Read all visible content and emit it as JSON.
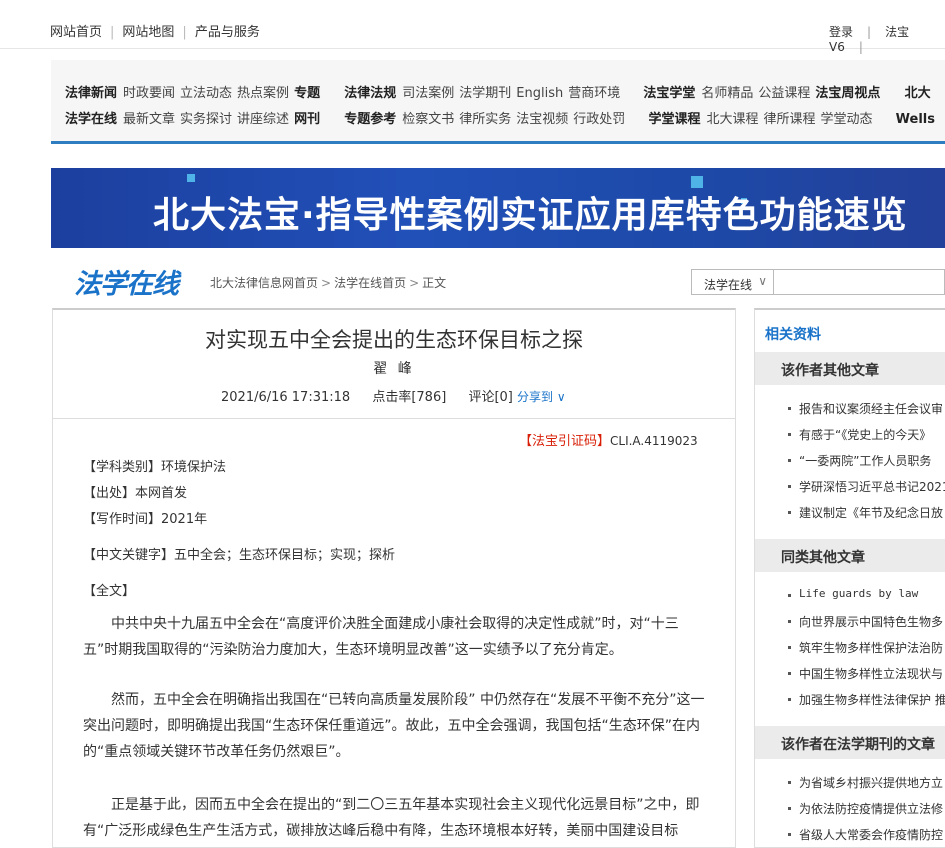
{
  "topbar": {
    "left_links": [
      "网站首页",
      "网站地图",
      "产品与服务"
    ],
    "login": "登录",
    "version": "法宝V6"
  },
  "nav": {
    "row1": [
      {
        "head": "法律新闻",
        "items": [
          "时政要闻",
          "立法动态",
          "热点案例"
        ],
        "tail": "专题"
      },
      {
        "head": "法律法规",
        "items": [
          "司法案例",
          "法学期刊",
          "English",
          "营商环境"
        ]
      },
      {
        "head": "法宝学堂",
        "items": [
          "名师精品",
          "公益课程"
        ],
        "tail": "法宝周视点"
      },
      {
        "head": "北大",
        "items": []
      }
    ],
    "row2": [
      {
        "head": "法学在线",
        "items": [
          "最新文章",
          "实务探讨",
          "讲座综述"
        ],
        "tail": "网刊"
      },
      {
        "head": "专题参考",
        "items": [
          "检察文书",
          "律所实务",
          "法宝视频",
          "行政处罚"
        ]
      },
      {
        "head": "学堂课程",
        "items": [
          "北大课程",
          "律所课程",
          "学堂动态"
        ]
      },
      {
        "head": "Wells",
        "items": []
      }
    ]
  },
  "banner": {
    "text": "北大法宝·指导性案例实证应用库特色功能速览"
  },
  "logo": "法学在线",
  "breadcrumb": [
    "北大法律信息网首页",
    "法学在线首页",
    "正文"
  ],
  "search": {
    "select_value": "法学在线",
    "placeholder": ""
  },
  "article": {
    "title": "对实现五中全会提出的生态环保目标之探",
    "author": "翟 峰",
    "datetime": "2021/6/16 17:31:18",
    "clicks": "点击率[786]",
    "comments": "评论[0]",
    "share": "分享到 ∨",
    "cite_tag": "【法宝引证码】",
    "cite_code": "CLI.A.4119023",
    "fields": {
      "category": "【学科类别】环境保护法",
      "source": "【出处】本网首发",
      "written": "【写作时间】2021年",
      "keywords": "【中文关键字】五中全会；生态环保目标；实现；探析",
      "fulltext": "【全文】"
    },
    "paragraphs": [
      "中共中央十九届五中全会在“高度评价决胜全面建成小康社会取得的决定性成就”时，对“十三五”时期我国取得的“污染防治力度加大，生态环境明显改善”这一实绩予以了充分肯定。",
      "然而，五中全会在明确指出我国在“已转向高质量发展阶段” 中仍然存在“发展不平衡不充分”这一突出问题时，即明确提出我国“生态环保任重道远”。故此，五中全会强调，我国包括“生态环保”在内的“重点领域关键环节改革任务仍然艰巨”。",
      "正是基于此，因而五中全会在提出的“到二〇三五年基本实现社会主义现代化远景目标”之中，即有“广泛形成绿色生产生活方式，碳排放达峰后稳中有降，生态环境根本好转，美丽中国建设目标"
    ]
  },
  "sidebar": {
    "related": "相关资料",
    "sections": [
      {
        "title": "该作者其他文章",
        "items": [
          "报告和议案须经主任会议审",
          "有感于“《党史上的今天》",
          "“一委两院”工作人员职务",
          "学研深悟习近平总书记2021",
          "建议制定《年节及纪念日放"
        ]
      },
      {
        "title": "同类其他文章",
        "items": [
          "Life guards by law",
          "向世界展示中国特色生物多",
          "筑牢生物多样性保护法治防",
          "中国生物多样性立法现状与",
          "加强生物多样性法律保护 推"
        ]
      },
      {
        "title": "该作者在法学期刊的文章",
        "items": [
          "为省域乡村振兴提供地方立",
          "为依法防控疫情提供立法修",
          "省级人大常委会作疫情防控"
        ]
      }
    ]
  }
}
